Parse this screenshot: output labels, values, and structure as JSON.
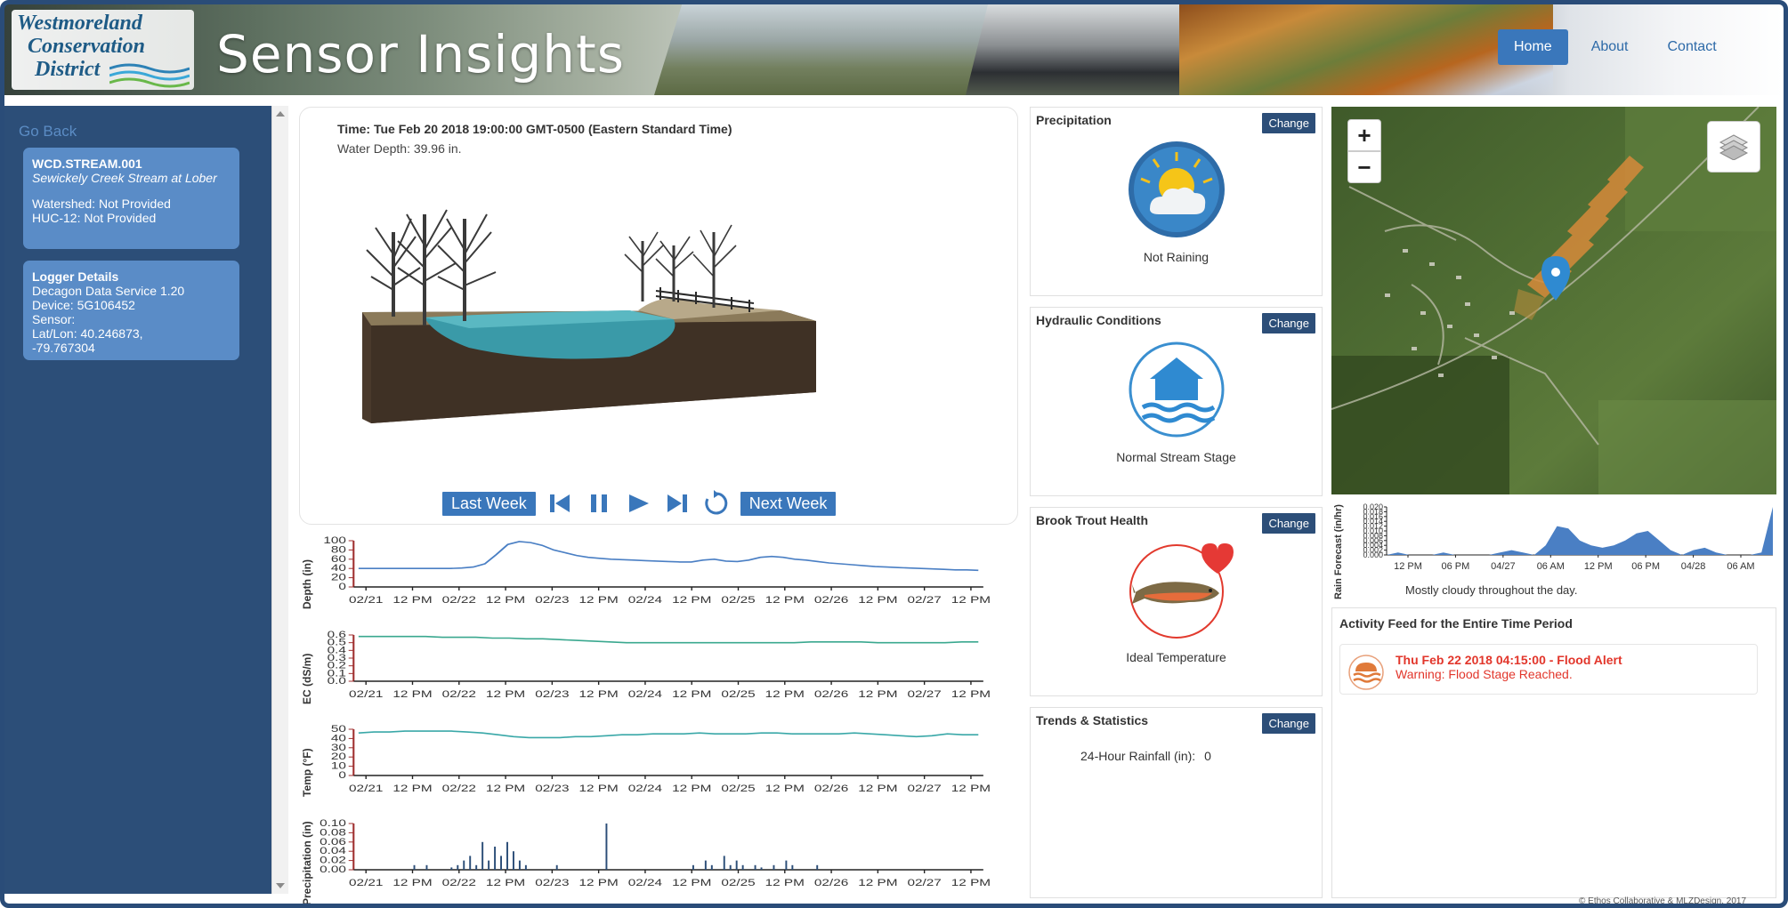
{
  "header": {
    "logo_line1": "Westmoreland",
    "logo_line2": "Conservation",
    "logo_line3": "District",
    "app_title": "Sensor Insights",
    "nav": [
      {
        "label": "Home",
        "active": true
      },
      {
        "label": "About",
        "active": false
      },
      {
        "label": "Contact",
        "active": false
      }
    ]
  },
  "sidebar": {
    "go_back": "Go Back",
    "station": {
      "id": "WCD.STREAM.001",
      "name": "Sewickely Creek Stream at Lober",
      "watershed": "Watershed: Not Provided",
      "huc": "HUC-12: Not Provided"
    },
    "logger": {
      "title": "Logger Details",
      "service": "Decagon Data Service 1.20",
      "device": "Device: 5G106452",
      "sensor": "Sensor:",
      "latlon_1": "Lat/Lon: 40.246873,",
      "latlon_2": "-79.767304"
    }
  },
  "viz": {
    "time": "Time: Tue Feb 20 2018 19:00:00 GMT-0500 (Eastern Standard Time)",
    "water_depth": "Water Depth: 39.96 in.",
    "last_week": "Last Week",
    "next_week": "Next Week"
  },
  "charts": {
    "x_ticks": [
      "02/21",
      "12 PM",
      "02/22",
      "12 PM",
      "02/23",
      "12 PM",
      "02/24",
      "12 PM",
      "02/25",
      "12 PM",
      "02/26",
      "12 PM",
      "02/27",
      "12 PM"
    ],
    "depth": {
      "label": "Depth (in)",
      "ticks": [
        "100",
        "80",
        "60",
        "40",
        "20",
        "0"
      ],
      "ymax": 100,
      "color": "#4a7fc4",
      "values": [
        40,
        40,
        40,
        40,
        40,
        40,
        40,
        40,
        40,
        41,
        43,
        50,
        70,
        92,
        98,
        96,
        90,
        80,
        74,
        68,
        64,
        62,
        60,
        59,
        58,
        57,
        56,
        55,
        54,
        54,
        58,
        60,
        56,
        55,
        58,
        64,
        66,
        64,
        60,
        58,
        55,
        52,
        50,
        48,
        46,
        44,
        43,
        42,
        41,
        40,
        39,
        38,
        37,
        37,
        36
      ]
    },
    "ec": {
      "label": "EC (dS/m)",
      "ticks": [
        "0.6",
        "0.5",
        "0.4",
        "0.3",
        "0.2",
        "0.1",
        "0.0"
      ],
      "ymax": 0.6,
      "color": "#3aa88f",
      "values": [
        0.58,
        0.58,
        0.58,
        0.58,
        0.58,
        0.57,
        0.57,
        0.57,
        0.56,
        0.56,
        0.55,
        0.55,
        0.54,
        0.53,
        0.52,
        0.51,
        0.5,
        0.5,
        0.5,
        0.5,
        0.5,
        0.5,
        0.5,
        0.5,
        0.5,
        0.5,
        0.5,
        0.51,
        0.51,
        0.51,
        0.51,
        0.5,
        0.5,
        0.5,
        0.5,
        0.5,
        0.51,
        0.51
      ]
    },
    "temp": {
      "label": "Temp (°F)",
      "ticks": [
        "50",
        "40",
        "30",
        "20",
        "10",
        "0"
      ],
      "ymax": 50,
      "color": "#3aa8a8",
      "values": [
        46,
        47,
        47,
        48,
        48,
        48,
        48,
        47,
        46,
        44,
        42,
        41,
        41,
        41,
        42,
        42,
        43,
        44,
        44,
        45,
        45,
        45,
        46,
        45,
        45,
        45,
        46,
        46,
        45,
        45,
        45,
        45,
        46,
        45,
        44,
        43,
        42,
        43,
        45,
        44,
        44
      ]
    },
    "precip": {
      "label": "Precipitation (in)",
      "ticks": [
        "0.10",
        "0.08",
        "0.06",
        "0.04",
        "0.02",
        "0.00"
      ],
      "ymax": 0.1,
      "color": "#2c4e78",
      "values": [
        0,
        0,
        0,
        0,
        0,
        0,
        0,
        0,
        0,
        0.01,
        0,
        0.01,
        0,
        0,
        0,
        0.005,
        0.01,
        0.02,
        0.03,
        0.01,
        0.06,
        0.02,
        0.05,
        0.03,
        0.06,
        0.04,
        0.02,
        0.01,
        0,
        0,
        0,
        0,
        0.01,
        0,
        0,
        0,
        0,
        0,
        0,
        0,
        0.1,
        0,
        0,
        0,
        0,
        0,
        0,
        0,
        0,
        0,
        0,
        0,
        0,
        0,
        0.01,
        0,
        0.02,
        0.01,
        0,
        0.03,
        0.01,
        0.02,
        0.01,
        0,
        0.01,
        0.005,
        0,
        0.01,
        0,
        0.02,
        0.01,
        0,
        0,
        0,
        0.01,
        0,
        0,
        0,
        0,
        0,
        0,
        0,
        0,
        0,
        0,
        0,
        0,
        0,
        0,
        0,
        0,
        0,
        0,
        0,
        0,
        0,
        0,
        0,
        0,
        0,
        0
      ]
    }
  },
  "widgets": {
    "change_label": "Change",
    "precipitation": {
      "title": "Precipitation",
      "status": "Not Raining"
    },
    "hydraulic": {
      "title": "Hydraulic Conditions",
      "status": "Normal Stream Stage"
    },
    "trout": {
      "title": "Brook Trout Health",
      "status": "Ideal Temperature"
    },
    "trends": {
      "title": "Trends & Statistics",
      "rainfall_label": "24-Hour Rainfall (in):",
      "rainfall_value": "0"
    }
  },
  "map": {
    "zoom_in": "+",
    "zoom_out": "−"
  },
  "forecast": {
    "label": "Rain Forecast (in/hr)",
    "y_ticks": [
      "0.020",
      "0.018",
      "0.016",
      "0.014",
      "0.012",
      "0.010",
      "0.008",
      "0.006",
      "0.004",
      "0.002",
      "0.000"
    ],
    "x_ticks": [
      "12 PM",
      "06 PM",
      "04/27",
      "06 AM",
      "12 PM",
      "06 PM",
      "04/28",
      "06 AM"
    ],
    "summary": "Mostly cloudy throughout the day.",
    "color": "#4a7fc4",
    "values": [
      0,
      0.001,
      0,
      0,
      0,
      0.001,
      0,
      0,
      0,
      0,
      0.001,
      0.002,
      0.001,
      0,
      0.004,
      0.012,
      0.011,
      0.006,
      0.004,
      0.003,
      0.004,
      0.006,
      0.009,
      0.01,
      0.006,
      0.002,
      0,
      0.002,
      0.003,
      0.001,
      0,
      0,
      0,
      0.001,
      0.02
    ]
  },
  "feed": {
    "title": "Activity Feed for the Entire Time Period",
    "item_title": "Thu Feb 22 2018 04:15:00 - Flood Alert",
    "item_message": "Warning: Flood Stage Reached."
  },
  "footer": {
    "copyright": "© Ethos Collaborative & MLZDesign, 2017"
  }
}
